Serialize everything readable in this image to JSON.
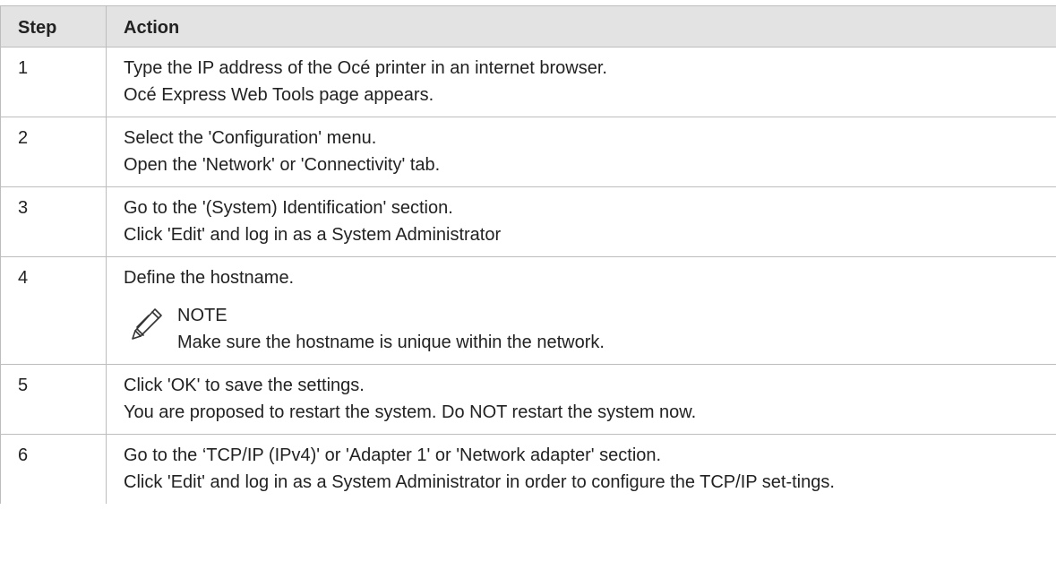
{
  "table": {
    "headers": {
      "step": "Step",
      "action": "Action"
    },
    "rows": [
      {
        "step": "1",
        "lines": [
          "Type the IP address of the Océ printer in an internet browser.",
          "Océ Express Web Tools page appears."
        ]
      },
      {
        "step": "2",
        "lines": [
          "Select the 'Configuration' menu.",
          "Open the 'Network' or 'Connectivity' tab."
        ]
      },
      {
        "step": "3",
        "lines": [
          "Go to the '(System) Identification' section.",
          "Click 'Edit' and log in as a System Administrator"
        ]
      },
      {
        "step": "4",
        "lines": [
          "Define the hostname."
        ],
        "note": {
          "icon": "pencil-icon",
          "label": "NOTE",
          "text": "Make sure the hostname is unique within the network."
        }
      },
      {
        "step": "5",
        "lines": [
          "Click 'OK' to save the settings.",
          "You are proposed to restart the system. Do NOT restart the system now."
        ]
      },
      {
        "step": "6",
        "lines": [
          "Go to the ‘TCP/IP (IPv4)' or 'Adapter 1' or 'Network adapter' section.",
          "Click 'Edit' and log in as a System Administrator in order to configure the TCP/IP set-tings."
        ]
      }
    ]
  }
}
